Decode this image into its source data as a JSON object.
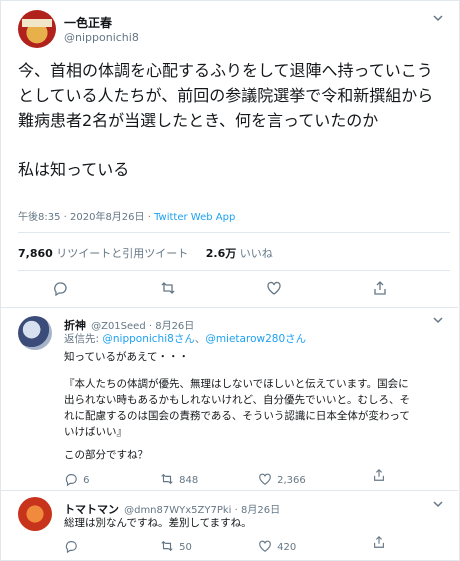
{
  "tweet": {
    "display_name": "一色正春",
    "handle": "@nipponichi8",
    "paragraph1": "今、首相の体調を心配するふりをして退陣へ持っていこうとしている人たちが、前回の参議院選挙で令和新撰組から難病患者2名が当選したとき、何を言っていたのか",
    "paragraph2": "私は知っている",
    "timestamp": "午後8:35 · 2020年8月26日 · ",
    "app": "Twitter Web App",
    "retweets_count": "7,860",
    "retweets_label": "リツイートと引用ツイート",
    "likes_count": "2.6万",
    "likes_label": "いいね"
  },
  "reply1": {
    "display_name": "折神",
    "handle": "@Z01Seed · 8月26日",
    "reply_to_prefix": "返信先: ",
    "reply_to_1": "@nipponichi8さん",
    "reply_to_sep": "、",
    "reply_to_2": "@mietarow280さん",
    "line1": "知っているがあえて・・・",
    "quote_lines": [
      "『本人たちの体調が優先、無理はしないでほしいと伝えています。国会に",
      "出られない時もあるかもしれないけれど、自分優先でいいと。むしろ、そ",
      "れに配慮するのは国会の責務である、そういう認識に日本全体が変わって",
      "いけばいい』"
    ],
    "line_last": "この部分ですね？",
    "replies": "6",
    "retweets": "848",
    "likes": "2,366"
  },
  "reply2": {
    "display_name": "トマトマン",
    "handle": "@dmn87WYx5ZY7Pki · 8月26日",
    "text": "総理は別なんですね。差別してますね。",
    "replies": "",
    "retweets": "50",
    "likes": "420"
  },
  "icons": [
    "chevron-down-icon",
    "reply-icon",
    "retweet-icon",
    "like-icon",
    "share-icon"
  ],
  "colors": {
    "link": "#1da1f2",
    "muted": "#657786",
    "divider": "#e1e8ed"
  }
}
